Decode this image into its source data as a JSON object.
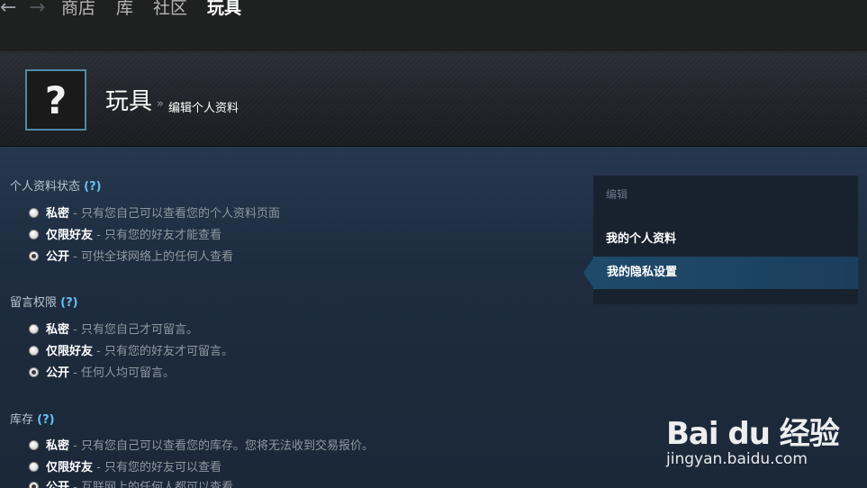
{
  "nav": {
    "back_icon": "←",
    "forward_icon": "→",
    "store": "商店",
    "library": "库",
    "community": "社区",
    "user": "玩具"
  },
  "header": {
    "avatar_placeholder": "?",
    "persona_name": "玩具",
    "separator": "»",
    "page": "编辑个人资料"
  },
  "sections": {
    "profile": {
      "title": "个人资料状态",
      "help": "(?)",
      "options": [
        {
          "name": "私密",
          "desc": " - 只有您自己可以查看您的个人资料页面",
          "checked": false
        },
        {
          "name": "仅限好友",
          "desc": " - 只有您的好友才能查看",
          "checked": false
        },
        {
          "name": "公开",
          "desc": " - 可供全球网络上的任何人查看",
          "checked": true
        }
      ]
    },
    "comments": {
      "title": "留言权限",
      "help": "(?)",
      "options": [
        {
          "name": "私密",
          "desc": " - 只有您自己才可留言。",
          "checked": false
        },
        {
          "name": "仅限好友",
          "desc": " - 只有您的好友才可留言。",
          "checked": false
        },
        {
          "name": "公开",
          "desc": " - 任何人均可留言。",
          "checked": true
        }
      ]
    },
    "inventory": {
      "title": "库存",
      "help": "(?)",
      "options": [
        {
          "name": "私密",
          "desc": " - 只有您自己可以查看您的库存。您将无法收到交易报价。",
          "checked": false
        },
        {
          "name": "仅限好友",
          "desc": " - 只有您的好友可以查看",
          "checked": false
        },
        {
          "name": "公开",
          "desc": " - 互联网上的任何人都可以查看",
          "checked": true
        }
      ]
    }
  },
  "sidebar": {
    "title": "编辑",
    "items": [
      {
        "label": "我的个人资料"
      },
      {
        "label": "我的隐私设置"
      }
    ]
  },
  "watermark": {
    "logo": "Bai du 经验",
    "url": "jingyan.baidu.com"
  },
  "colors": {
    "accent": "#66c0f4",
    "background": "#1b2838",
    "selected": "#1f4a6a"
  }
}
